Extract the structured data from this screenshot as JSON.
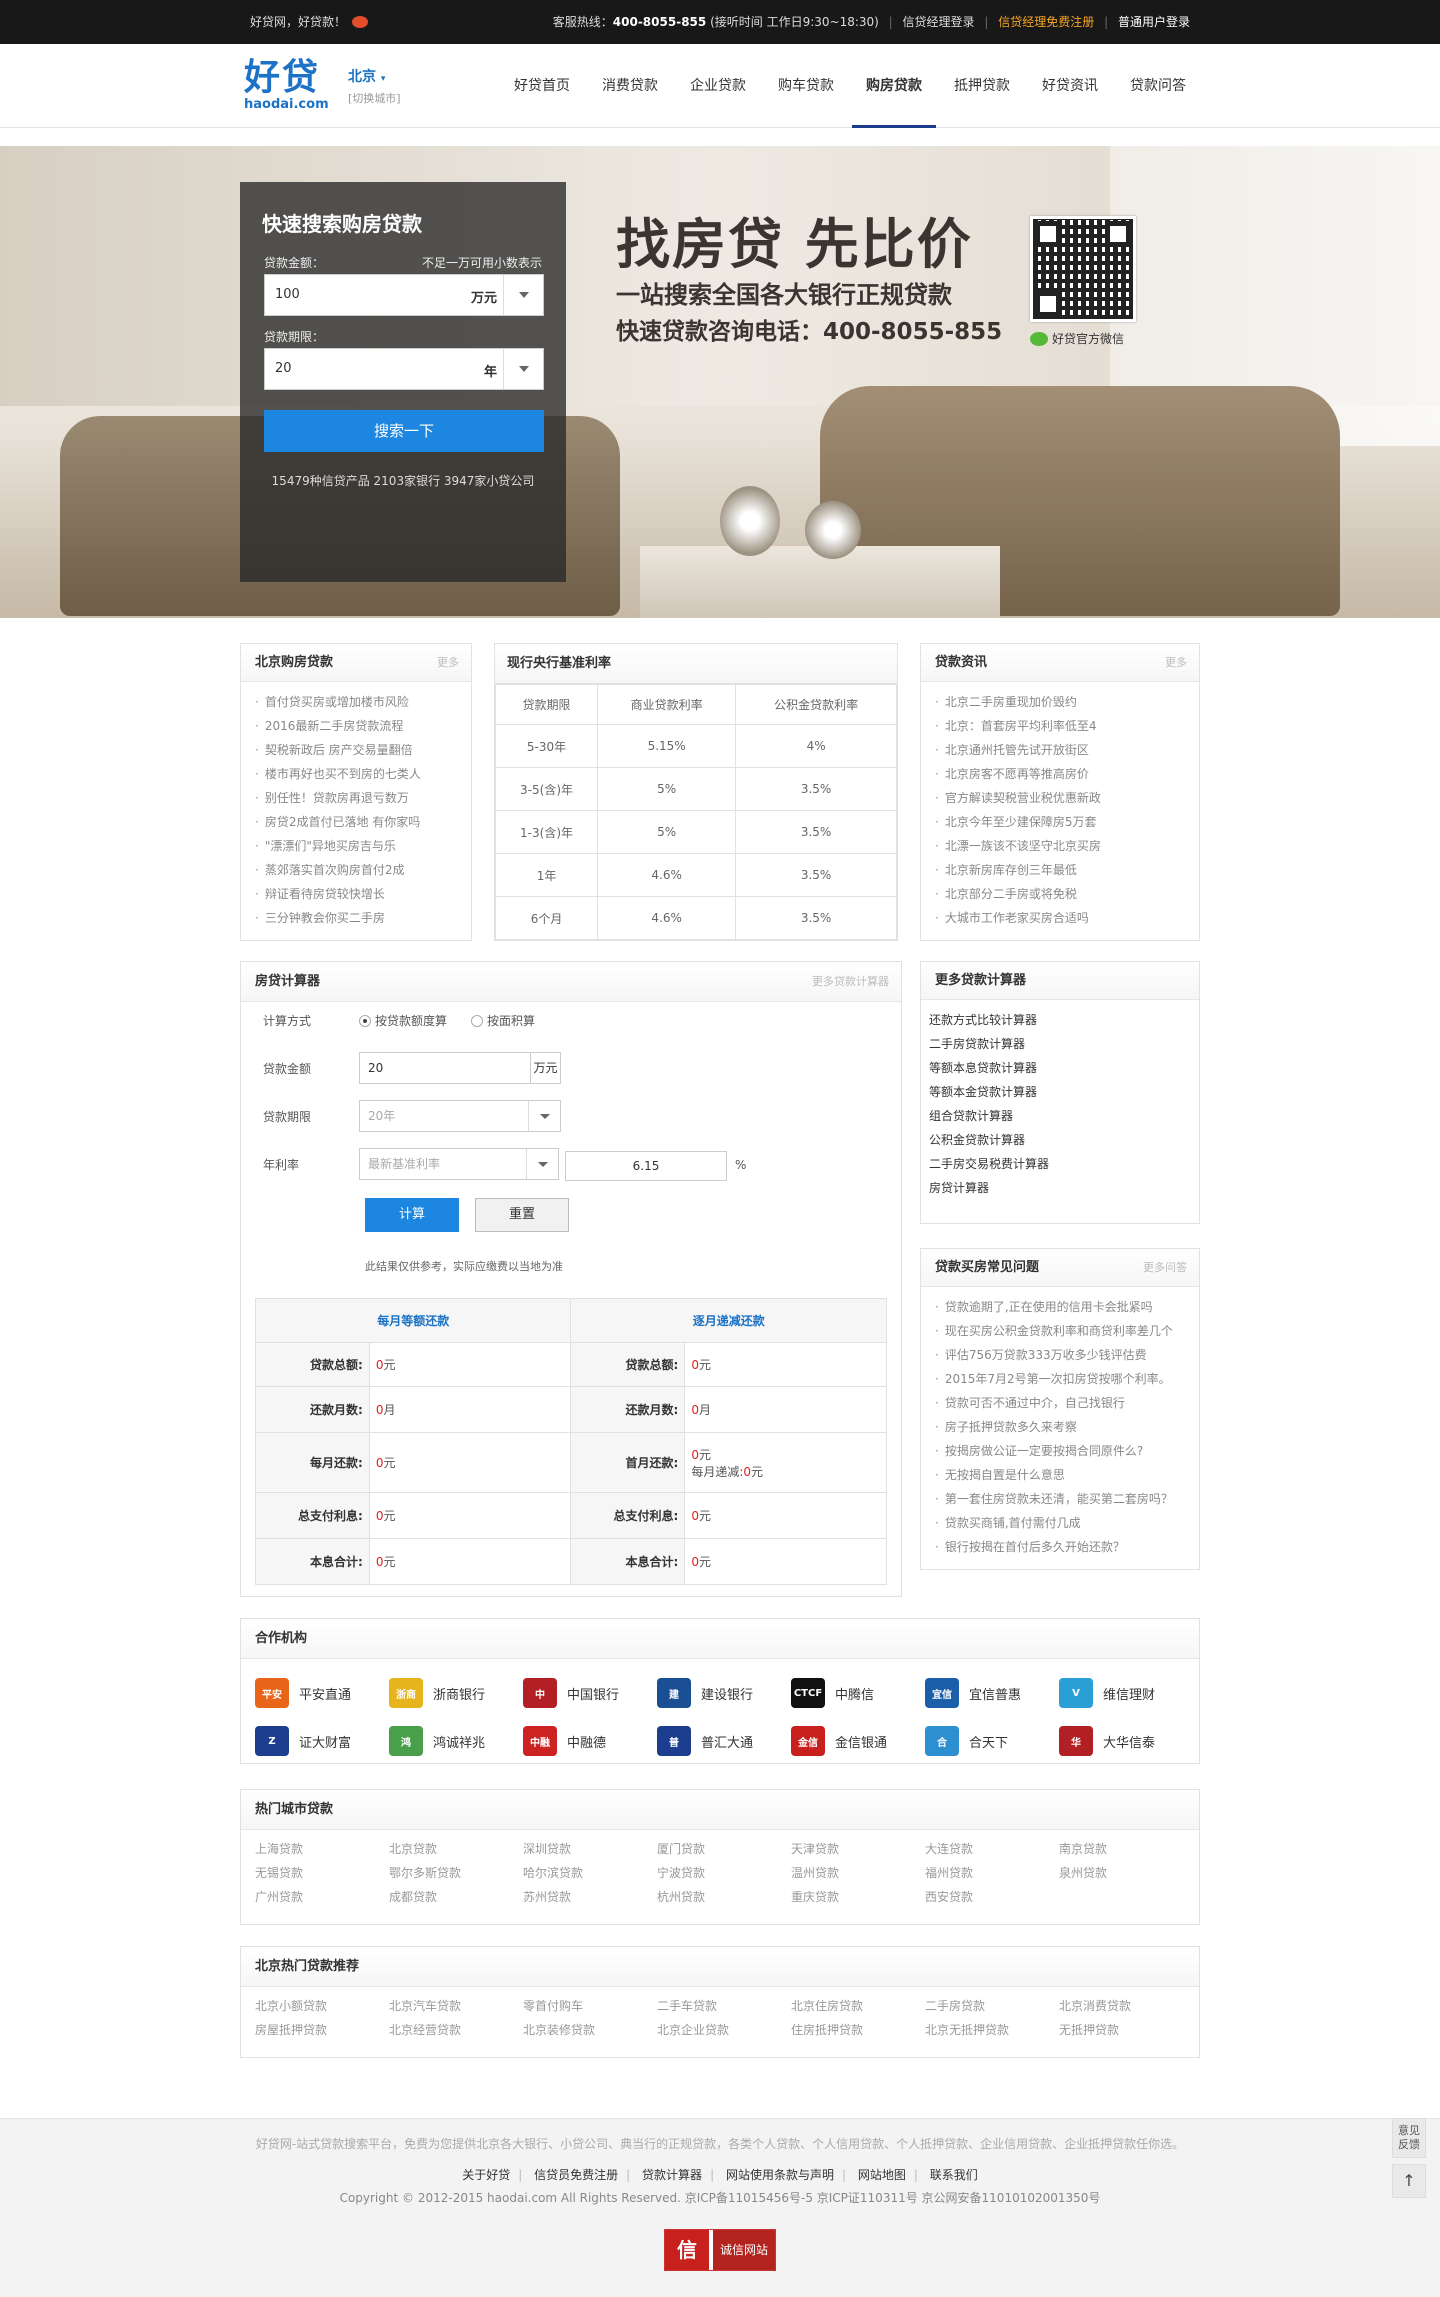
{
  "topbar": {
    "welcome": "好贷网，好贷款！",
    "hotline_label": "客服热线：",
    "hotline": "400-8055-855",
    "hours": "(接听时间 工作日9:30~18:30)",
    "links": [
      "信贷经理登录",
      "信贷经理免费注册",
      "普通用户登录"
    ]
  },
  "logo": {
    "cn": "好贷",
    "en": "haodai.com"
  },
  "city": {
    "name": "北京",
    "switch": "[切换城市]"
  },
  "nav": [
    "好贷首页",
    "消费贷款",
    "企业贷款",
    "购车贷款",
    "购房贷款",
    "抵押贷款",
    "好贷资讯",
    "贷款问答"
  ],
  "nav_active": 4,
  "search": {
    "title": "快速搜索购房贷款",
    "amount_label": "贷款金额：",
    "amount_hint": "不足一万可用小数表示",
    "amount_value": "100",
    "amount_unit": "万元",
    "term_label": "贷款期限：",
    "term_value": "20",
    "term_unit": "年",
    "button": "搜索一下",
    "stats": "15479种信贷产品 2103家银行 3947家小贷公司"
  },
  "slogan": {
    "line1": "找房贷 先比价",
    "line2": "一站搜索全国各大银行正规贷款",
    "line3": "快速贷款咨询电话：400-8055-855",
    "wechat": "好贷官方微信"
  },
  "beijing_loans": {
    "title": "北京购房贷款",
    "more": "更多",
    "items": [
      "首付贷买房或增加楼市风险",
      "2016最新二手房贷款流程",
      "契税新政后 房产交易量翻倍",
      "楼市再好也买不到房的七类人",
      "别任性！贷款房再退亏数万",
      "房贷2成首付已落地 有你家吗",
      "\"漂漂们\"异地买房吉与乐",
      "蒸郊落实首次购房首付2成",
      "辩证看待房贷较快增长",
      "三分钟教会你买二手房"
    ]
  },
  "rates": {
    "title": "现行央行基准利率",
    "headers": [
      "贷款期限",
      "商业贷款利率",
      "公积金贷款利率"
    ],
    "rows": [
      [
        "5-30年",
        "5.15%",
        "4%"
      ],
      [
        "3-5(含)年",
        "5%",
        "3.5%"
      ],
      [
        "1-3(含)年",
        "5%",
        "3.5%"
      ],
      [
        "1年",
        "4.6%",
        "3.5%"
      ],
      [
        "6个月",
        "4.6%",
        "3.5%"
      ]
    ]
  },
  "news": {
    "title": "贷款资讯",
    "more": "更多",
    "items": [
      "北京二手房重现加价毁约",
      "北京：首套房平均利率低至4",
      "北京通州托管先试开放街区",
      "北京房客不愿再等推高房价",
      "官方解读契税营业税优惠新政",
      "北京今年至少建保障房5万套",
      "北漂一族该不该坚守北京买房",
      "北京新房库存创三年最低",
      "北京部分二手房或将免税",
      "大城市工作老家买房合适吗"
    ]
  },
  "calc": {
    "title": "房贷计算器",
    "more": "更多贷款计算器",
    "method_label": "计算方式",
    "method_opt1": "按贷款额度算",
    "method_opt2": "按面积算",
    "amount_label": "贷款金额",
    "amount_value": "20",
    "amount_unit": "万元",
    "term_label": "贷款期限",
    "term_value": "20年",
    "rate_label": "年利率",
    "rate_select": "最新基准利率",
    "rate_value": "6.15",
    "rate_unit": "%",
    "btn_calc": "计算",
    "btn_reset": "重置",
    "note": "此结果仅供参考，实际应缴费以当地为准",
    "col1": "每月等额还款",
    "col2": "逐月递减还款",
    "rows": [
      [
        "贷款总额:",
        "0",
        "元",
        "贷款总额:",
        "0",
        "元"
      ],
      [
        "还款月数:",
        "0",
        "月",
        "还款月数:",
        "0",
        "月"
      ],
      [
        "每月还款:",
        "0",
        "元",
        "首月还款:",
        "0",
        "元"
      ],
      [
        "总支付利息:",
        "0",
        "元",
        "总支付利息:",
        "0",
        "元"
      ],
      [
        "本息合计:",
        "0",
        "元",
        "本息合计:",
        "0",
        "元"
      ]
    ],
    "monthly_decrease_label": "每月递减:",
    "monthly_decrease_value": "0",
    "monthly_decrease_unit": "元"
  },
  "more_calcs": {
    "title": "更多贷款计算器",
    "items": [
      "还款方式比较计算器",
      "二手房贷款计算器",
      "等额本息贷款计算器",
      "等额本金贷款计算器",
      "组合贷款计算器",
      "公积金贷款计算器",
      "二手房交易税费计算器",
      "房贷计算器"
    ]
  },
  "faq": {
    "title": "贷款买房常见问题",
    "more": "更多问答",
    "items": [
      "贷款逾期了,正在使用的信用卡会批紧吗",
      "现在买房公积金贷款利率和商贷利率差几个",
      "评估756万贷款333万收多少钱评估费",
      "2015年7月2号第一次扣房贷按哪个利率。",
      "贷款可否不通过中介，自己找银行",
      "房子抵押贷款多久来考察",
      "按揭房做公证一定要按揭合同原件么?",
      "无按揭自置是什么意思",
      "第一套住房贷款未还清，能买第二套房吗？",
      "贷款买商铺,首付需付几成",
      "银行按揭在首付后多久开始还款？"
    ]
  },
  "partners": {
    "title": "合作机构",
    "items": [
      {
        "name": "平安直通",
        "icon": "pingan-logo-icon",
        "color": "#e8651a",
        "abbr": "平安"
      },
      {
        "name": "浙商银行",
        "icon": "czbank-logo-icon",
        "color": "#e6b41c",
        "abbr": "浙商"
      },
      {
        "name": "中国银行",
        "icon": "boc-logo-icon",
        "color": "#b21f24",
        "abbr": "中"
      },
      {
        "name": "建设银行",
        "icon": "ccb-logo-icon",
        "color": "#1b4f93",
        "abbr": "建"
      },
      {
        "name": "中腾信",
        "icon": "ctcf-logo-icon",
        "color": "#111111",
        "abbr": "CTCF"
      },
      {
        "name": "宜信普惠",
        "icon": "creditease-logo-icon",
        "color": "#1b5fab",
        "abbr": "宜信"
      },
      {
        "name": "维信理财",
        "icon": "weixin-finance-logo-icon",
        "color": "#2a9fd6",
        "abbr": "V"
      },
      {
        "name": "证大财富",
        "icon": "zendai-logo-icon",
        "color": "#1d3d8f",
        "abbr": "Z"
      },
      {
        "name": "鸿诚祥兆",
        "icon": "hongcheng-logo-icon",
        "color": "#4aa04a",
        "abbr": "鸿"
      },
      {
        "name": "中融德",
        "icon": "zhongrongde-logo-icon",
        "color": "#cc2222",
        "abbr": "中融"
      },
      {
        "name": "普汇大通",
        "icon": "puhui-logo-icon",
        "color": "#1d3d8f",
        "abbr": "普"
      },
      {
        "name": "金信银通",
        "icon": "jinxin-logo-icon",
        "color": "#c8201d",
        "abbr": "金信"
      },
      {
        "name": "合天下",
        "icon": "hetianxia-logo-icon",
        "color": "#2b8fd0",
        "abbr": "合"
      },
      {
        "name": "大华信泰",
        "icon": "dahua-logo-icon",
        "color": "#b21f24",
        "abbr": "华"
      }
    ]
  },
  "hot_cities": {
    "title": "热门城市贷款",
    "items": [
      "上海贷款",
      "北京贷款",
      "深圳贷款",
      "厦门贷款",
      "天津贷款",
      "大连贷款",
      "南京贷款",
      "无锡贷款",
      "鄂尔多斯贷款",
      "哈尔滨贷款",
      "宁波贷款",
      "温州贷款",
      "福州贷款",
      "泉州贷款",
      "广州贷款",
      "成都贷款",
      "苏州贷款",
      "杭州贷款",
      "重庆贷款",
      "西安贷款"
    ]
  },
  "hot_loans": {
    "title": "北京热门贷款推荐",
    "items": [
      "北京小额贷款",
      "北京汽车贷款",
      "零首付购车",
      "二手车贷款",
      "北京住房贷款",
      "二手房贷款",
      "北京消费贷款",
      "房屋抵押贷款",
      "北京经营贷款",
      "北京装修贷款",
      "北京企业贷款",
      "住房抵押贷款",
      "北京无抵押贷款",
      "无抵押贷款"
    ]
  },
  "footer": {
    "desc": "好贷网-站式贷款搜索平台，免费为您提供北京各大银行、小贷公司、典当行的正规贷款，各类个人贷款、个人信用贷款、个人抵押贷款、企业信用贷款、企业抵押贷款任你选。",
    "links": [
      "关于好贷",
      "信贷员免费注册",
      "贷款计算器",
      "网站使用条款与声明",
      "网站地图",
      "联系我们"
    ],
    "copyright": "Copyright © 2012-2015 haodai.com All Rights Reserved. 京ICP备11015456号-5 京ICP证110311号 京公网安备11010102001350号",
    "badge_icon": "信",
    "badge_text": "诚信网站",
    "feedback": "意见反馈",
    "top": "↑"
  }
}
